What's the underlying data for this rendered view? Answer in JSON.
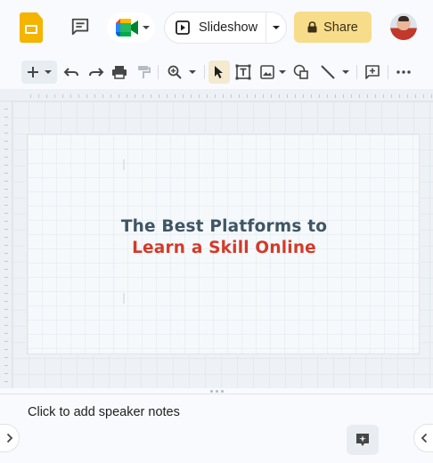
{
  "header": {
    "logo_icon": "slides-logo-icon",
    "comment_icon": "comment-history-icon",
    "meet_icon": "google-meet-icon",
    "slideshow_label": "Slideshow",
    "share_label": "Share",
    "share_icon": "lock-icon",
    "avatar_icon": "user-avatar"
  },
  "toolbar": {
    "items": [
      "new-slide-icon",
      "undo-icon",
      "redo-icon",
      "print-icon",
      "paint-format-icon",
      "zoom-icon",
      "select-icon",
      "text-box-icon",
      "insert-image-icon",
      "shape-icon",
      "line-icon",
      "add-comment-icon",
      "more-options-icon"
    ]
  },
  "slide": {
    "title_line1": "The Best Platforms to",
    "title_line2": "Learn a Skill Online",
    "title_color_1": "#3f5564",
    "title_color_2": "#d43a2a"
  },
  "notes": {
    "placeholder": "Click to add speaker notes"
  },
  "colors": {
    "accent": "#f4b400",
    "share_bg": "#f7dc8a"
  }
}
